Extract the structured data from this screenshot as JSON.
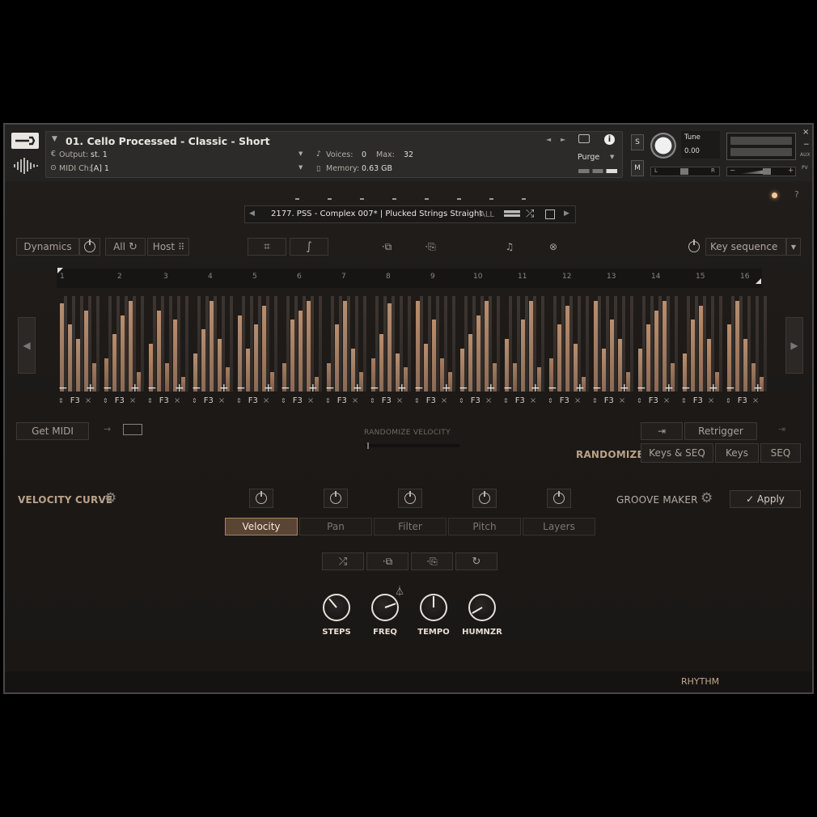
{
  "header": {
    "instrument_name": "01. Cello Processed - Classic - Short",
    "output_label": "Output:",
    "output_value": "st. 1",
    "voices_label": "Voices:",
    "voices_value": "0",
    "max_label": "Max:",
    "max_value": "32",
    "midi_label": "MIDI Ch:",
    "midi_value": "[A] 1",
    "memory_label": "Memory:",
    "memory_value": "0.63 GB",
    "purge_label": "Purge",
    "s_label": "S",
    "m_label": "M",
    "tune_label": "Tune",
    "tune_value": "0.00",
    "pan_l": "L",
    "pan_r": "R",
    "aux_label": "AUX",
    "pv_label": "PV",
    "vol_minus": "−",
    "vol_plus": "+"
  },
  "preset": {
    "name": "2177. PSS - Complex 007* | Plucked Strings Straight",
    "filter": "ALL"
  },
  "toolbar": {
    "dynamics_label": "Dynamics",
    "all_label": "All",
    "host_label": "Host",
    "key_sequence_label": "Key sequence"
  },
  "sequencer": {
    "step_numbers": [
      "1",
      "2",
      "3",
      "4",
      "5",
      "6",
      "7",
      "8",
      "9",
      "10",
      "11",
      "12",
      "13",
      "14",
      "15",
      "16"
    ],
    "note": "F3",
    "minus": "−",
    "plus": "+"
  },
  "midi": {
    "get_midi_label": "Get MIDI",
    "randomize_velocity_label": "RANDOMIZE VELOCITY",
    "retrigger_label": "Retrigger",
    "randomize_label": "RANDOMIZE",
    "keys_seq_label": "Keys & SEQ",
    "keys_label": "Keys",
    "seq_label": "SEQ"
  },
  "velocity_curve_label": "VELOCITY CURVE",
  "groove_maker_label": "GROOVE MAKER",
  "apply_label": "✓ Apply",
  "tabs": [
    {
      "label": "Velocity",
      "active": true
    },
    {
      "label": "Pan",
      "active": false
    },
    {
      "label": "Filter",
      "active": false
    },
    {
      "label": "Pitch",
      "active": false
    },
    {
      "label": "Layers",
      "active": false
    }
  ],
  "knobs": [
    {
      "label": "STEPS",
      "angle": -40
    },
    {
      "label": "FREQ",
      "angle": 70
    },
    {
      "label": "TEMPO",
      "angle": 0
    },
    {
      "label": "HUMNZR",
      "angle": -120
    }
  ],
  "footer": {
    "rhythm_label": "RHYTHM"
  },
  "colors": {
    "accent": "#a9835f",
    "accent_fill": "#5a4434",
    "bar_high": "#b98e6e",
    "bar_low": "#3d3530"
  },
  "icons": [
    "wrench-icon",
    "waveform-logo-icon",
    "camera-icon",
    "info-icon",
    "power-icon",
    "refresh-icon",
    "grid-icon",
    "crop-icon",
    "curve-icon",
    "copy-icon",
    "paste-icon",
    "headphones-icon",
    "random-icon",
    "save-icon",
    "metronome-icon",
    "chevron-left-icon",
    "chevron-right-icon",
    "arrow-right-icon",
    "midi-drag-icon",
    "settings-gear-icon"
  ],
  "step_bars": [
    [
      0.92,
      0.7,
      0.55,
      0.85,
      0.3
    ],
    [
      0.35,
      0.6,
      0.8,
      0.95,
      0.2
    ],
    [
      0.5,
      0.85,
      0.3,
      0.75,
      0.15
    ],
    [
      0.4,
      0.65,
      0.95,
      0.55,
      0.25
    ],
    [
      0.8,
      0.45,
      0.7,
      0.9,
      0.2
    ],
    [
      0.3,
      0.75,
      0.85,
      0.95,
      0.15
    ],
    [
      0.3,
      0.7,
      0.95,
      0.45,
      0.2
    ],
    [
      0.35,
      0.6,
      0.92,
      0.4,
      0.25
    ],
    [
      0.95,
      0.5,
      0.75,
      0.35,
      0.2
    ],
    [
      0.45,
      0.6,
      0.8,
      0.95,
      0.3
    ],
    [
      0.55,
      0.3,
      0.75,
      0.95,
      0.25
    ],
    [
      0.35,
      0.7,
      0.9,
      0.5,
      0.15
    ],
    [
      0.95,
      0.45,
      0.75,
      0.55,
      0.2
    ],
    [
      0.45,
      0.7,
      0.85,
      0.95,
      0.3
    ],
    [
      0.4,
      0.75,
      0.9,
      0.55,
      0.2
    ],
    [
      0.7,
      0.95,
      0.55,
      0.3,
      0.15
    ]
  ]
}
